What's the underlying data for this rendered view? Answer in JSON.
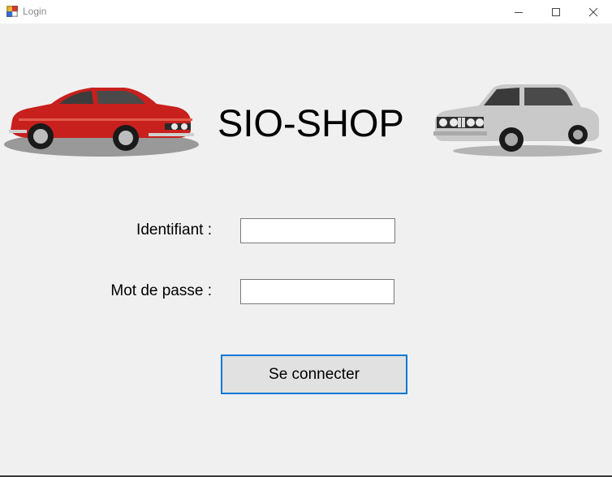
{
  "window": {
    "title": "Login"
  },
  "header": {
    "brand": "SIO-SHOP",
    "left_image": "red-classic-coupe",
    "right_image": "silver-classic-sedan"
  },
  "form": {
    "username_label": "Identifiant :",
    "username_value": "",
    "password_label": "Mot de passe :",
    "password_value": "",
    "submit_label": "Se connecter"
  },
  "colors": {
    "background": "#f0f0f0",
    "button_border": "#0078d7",
    "button_fill": "#e1e1e1"
  }
}
